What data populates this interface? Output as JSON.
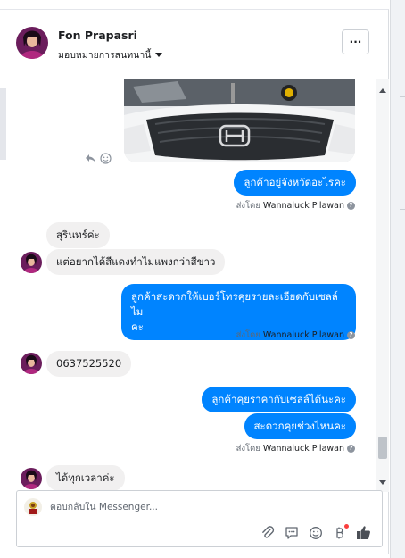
{
  "header": {
    "contact_name": "Fon Prapasri",
    "assign_label": "มอบหมายการสนทนานี้",
    "more_label": "···"
  },
  "messages": {
    "m1": "ลูกค้าอยู่จังหวัดอะไรคะ",
    "m2": "สุรินทร์ค่ะ",
    "m3": "แต่อยากได้สีแดงทำไมแพงกว่าสีขาว",
    "m4_line1": "ลูกค้าสะดวกให้เบอร์โทรคุยรายละเอียดกับเซลล์ไม",
    "m4_line2": "คะ",
    "m5": "0637525520",
    "m6": "ลูกค้าคุยราคากับเซลล์ได้นะคะ",
    "m7": "สะดวกคุยช่วงไหนคะ",
    "m8": "ได้ทุกเวลาค่ะ"
  },
  "sent_by": {
    "prefix": "ส่งโดย",
    "agent": "Wannaluck Pilawan",
    "help": "?"
  },
  "composer": {
    "placeholder": "ตอบกลับใน Messenger..."
  },
  "icons": [
    "reply-icon",
    "emoji-react-icon",
    "attachment-icon",
    "saved-reply-icon",
    "emoji-icon",
    "bitmoji-icon",
    "like-icon"
  ],
  "colors": {
    "outgoing_bubble": "#0084ff",
    "incoming_bubble": "#f1f0f0",
    "like_icon": "#4b4f56"
  }
}
